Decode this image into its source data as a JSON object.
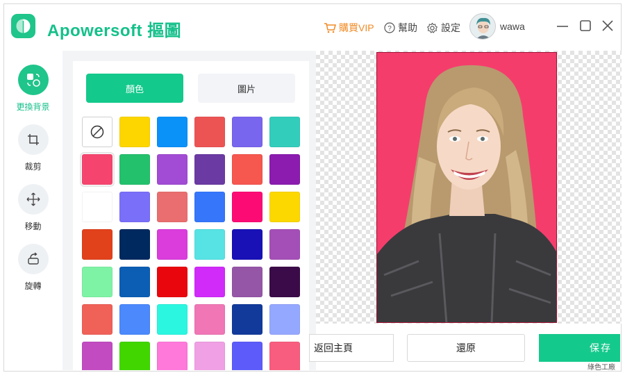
{
  "app": {
    "title": "Apowersoft 摳圖"
  },
  "header": {
    "vip_label": "購買VIP",
    "help_label": "幫助",
    "settings_label": "設定",
    "username": "wawa"
  },
  "tools": [
    {
      "label": "更換背景",
      "icon": "replace-background-icon",
      "active": true
    },
    {
      "label": "裁剪",
      "icon": "crop-icon",
      "active": false
    },
    {
      "label": "移動",
      "icon": "move-icon",
      "active": false
    },
    {
      "label": "旋轉",
      "icon": "rotate-icon",
      "active": false
    }
  ],
  "panel": {
    "tab_color": "顏色",
    "tab_image": "圖片",
    "selected_color": "#f5456f",
    "swatches": [
      [
        "none",
        "#fdd600",
        "#0b92f9",
        "#ec5454",
        "#7866ee",
        "#33cdbb"
      ],
      [
        "#f5456f",
        "#24c16d",
        "#a24bd4",
        "#6b3aa3",
        "#f6574f",
        "#8b1caf"
      ],
      [
        "#ffffff",
        "#7a6ff9",
        "#ea6e6f",
        "#3576fb",
        "#fd0b75",
        "#fdd800"
      ],
      [
        "#e1421c",
        "#00295f",
        "#da3ddc",
        "#57e3e4",
        "#1911b6",
        "#a44fb7"
      ],
      [
        "#7ef3a5",
        "#0b5eb4",
        "#e9070d",
        "#d12bfa",
        "#9656a8",
        "#3b0b49"
      ],
      [
        "#f06158",
        "#4b89fc",
        "#2bf7e0",
        "#f076b6",
        "#123a9b",
        "#95a8ff"
      ],
      [
        "#c24bc1",
        "#41d600",
        "#ff79db",
        "#f0a0e4",
        "#5d5cfa",
        "#f85d7f"
      ]
    ]
  },
  "buttons": {
    "back_label": "返回主頁",
    "restore_label": "還原",
    "save_label": "保存"
  },
  "watermark": "綠色工廠"
}
